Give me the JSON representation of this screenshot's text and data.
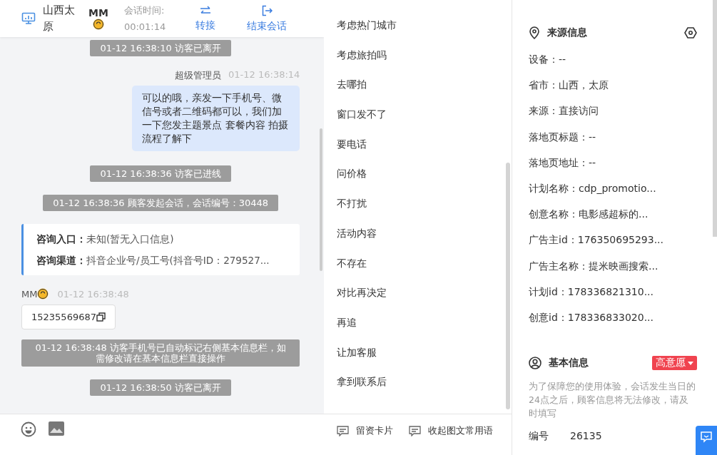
{
  "chat_header": {
    "location": "山西太原",
    "visitor": "MM",
    "timer_label": "会话时间:",
    "timer": "00:01:14",
    "actions": [
      {
        "kind": "transfer",
        "label": "转接"
      },
      {
        "kind": "end",
        "label": "结束会话"
      }
    ]
  },
  "messages": [
    {
      "kind": "system",
      "text": "01-12 16:38:10 访客已离开"
    },
    {
      "kind": "agent",
      "sender": "超级管理员",
      "time": "01-12 16:38:14",
      "text": "可以的哦，亲发一下手机号、微信号或者二维码都可以，我们加一下您发主题景点 套餐内容 拍摄流程了解下"
    },
    {
      "kind": "system",
      "text": "01-12 16:38:36 访客已进线"
    },
    {
      "kind": "system",
      "text": "01-12 16:38:36 顾客发起会话，会话编号：30448"
    },
    {
      "kind": "info",
      "rows": [
        {
          "label": "咨询入口：",
          "value": "未知(暂无入口信息)"
        },
        {
          "label": "咨询渠道：",
          "value": "抖音企业号/员工号(抖音号ID：279527..."
        }
      ]
    },
    {
      "kind": "visitor",
      "sender": "MM",
      "time": "01-12 16:38:48",
      "text": "15235569687"
    },
    {
      "kind": "system",
      "text": "01-12 16:38:48 访客手机号已自动标记右侧基本信息栏，如需修改请在基本信息栏直接操作"
    },
    {
      "kind": "system",
      "text": "01-12 16:38:50 访客已离开"
    }
  ],
  "quick_replies": [
    "考虑热门城市",
    "考虑旅拍吗",
    "去哪拍",
    "窗口发不了",
    "要电话",
    "问价格",
    "不打扰",
    "活动内容",
    "不存在",
    "对比再决定",
    "再追",
    "让加客服",
    "拿到联系后"
  ],
  "toolbar": {
    "buttons": [
      "留资卡片",
      "收起图文常用语"
    ]
  },
  "source_info": {
    "title": "来源信息",
    "rows": [
      "设备：--",
      "省市：山西，太原",
      "来源：直接访问",
      "落地页标题：--",
      "落地页地址：--",
      "计划名称：cdp_promotio...",
      "创意名称：电影感超标的...",
      "广告主id：176350695293...",
      "广告主名称：提米映画搜索...",
      "计划id：178336821310...",
      "创意id：178336833020..."
    ]
  },
  "basic_info": {
    "title": "基本信息",
    "intent": "高意愿",
    "note": "为了保障您的使用体验，会话发生当日的24点之后，顾客信息将无法修改，请及时填写",
    "fields": [
      {
        "label": "编号",
        "value": "26135"
      }
    ]
  }
}
